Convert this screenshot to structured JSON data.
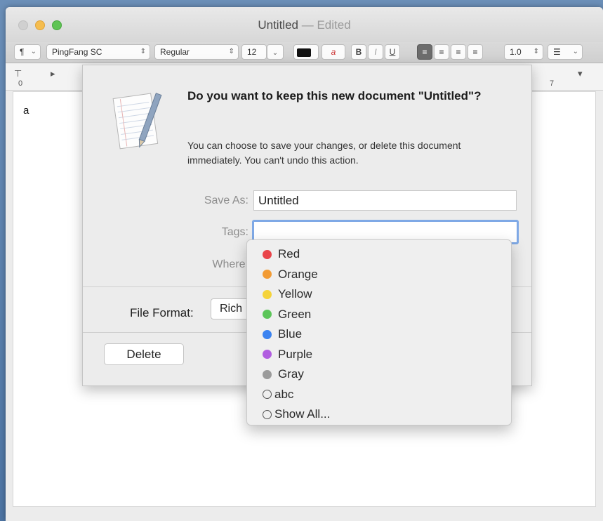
{
  "window": {
    "title": "Untitled",
    "title_suffix": "— Edited"
  },
  "toolbar": {
    "paragraph_style": "¶",
    "font_family": "PingFang SC",
    "font_style": "Regular",
    "font_size": "12",
    "bold": "B",
    "italic": "I",
    "underline": "U",
    "line_spacing": "1.0"
  },
  "ruler": {
    "left_num": "0",
    "right_num": "7"
  },
  "document": {
    "text": "a"
  },
  "dialog": {
    "heading": "Do you want to keep this new document \"Untitled\"?",
    "body": "You can choose to save your changes, or delete this document immediately. You can't undo this action.",
    "save_as_label": "Save As:",
    "save_as_value": "Untitled",
    "tags_label": "Tags:",
    "tags_value": "",
    "where_label": "Where:",
    "file_format_label": "File Format:",
    "file_format_value": "Rich",
    "delete_label": "Delete"
  },
  "tags_menu": {
    "items": [
      {
        "label": "Red",
        "color": "#e9454a"
      },
      {
        "label": "Orange",
        "color": "#f29b34"
      },
      {
        "label": "Yellow",
        "color": "#f5d33a"
      },
      {
        "label": "Green",
        "color": "#5cc559"
      },
      {
        "label": "Blue",
        "color": "#3b83f0"
      },
      {
        "label": "Purple",
        "color": "#b15ee0"
      },
      {
        "label": "Gray",
        "color": "#9b9b9b"
      },
      {
        "label": "abc",
        "color": ""
      },
      {
        "label": "Show All...",
        "color": ""
      }
    ]
  }
}
